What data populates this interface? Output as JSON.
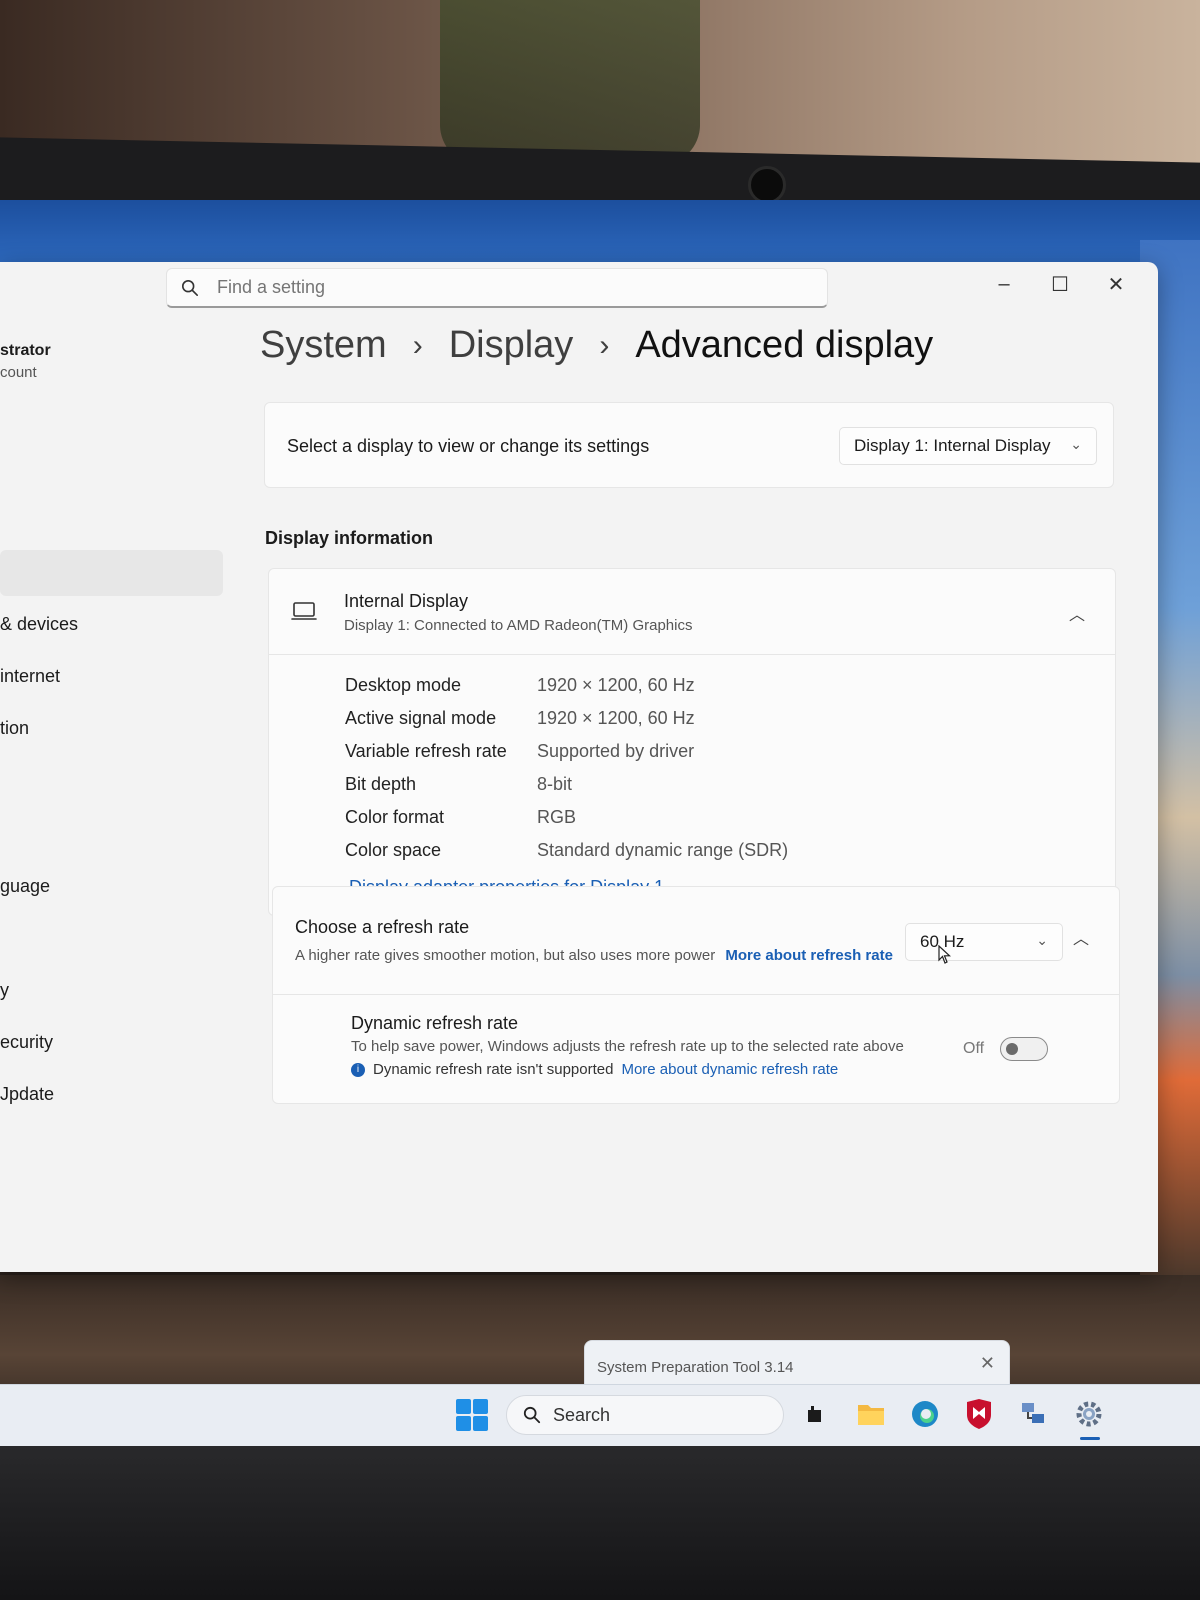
{
  "search": {
    "placeholder": "Find a setting"
  },
  "window_controls": {
    "minimize": "–",
    "maximize": "☐",
    "close": "✕"
  },
  "sidebar": {
    "user_name": "strator",
    "user_account": "count",
    "items": [
      {
        "label": "& devices"
      },
      {
        "label": "internet"
      },
      {
        "label": "tion"
      },
      {
        "label": "guage"
      },
      {
        "label": "y"
      },
      {
        "label": "ecurity"
      },
      {
        "label": "Jpdate"
      }
    ]
  },
  "breadcrumb": {
    "level1": "System",
    "level2": "Display",
    "current": "Advanced display",
    "separator": "›"
  },
  "select_display": {
    "label": "Select a display to view or change its settings",
    "value": "Display 1: Internal Display"
  },
  "display_info": {
    "section_title": "Display information",
    "name": "Internal Display",
    "subtitle": "Display 1: Connected to AMD Radeon(TM) Graphics",
    "properties": [
      {
        "key": "Desktop mode",
        "value": "1920 × 1200, 60 Hz"
      },
      {
        "key": "Active signal mode",
        "value": "1920 × 1200, 60 Hz"
      },
      {
        "key": "Variable refresh rate",
        "value": "Supported by driver"
      },
      {
        "key": "Bit depth",
        "value": "8-bit"
      },
      {
        "key": "Color format",
        "value": "RGB"
      },
      {
        "key": "Color space",
        "value": "Standard dynamic range (SDR)"
      }
    ],
    "adapter_link": "Display adapter properties for Display 1"
  },
  "refresh_rate": {
    "title": "Choose a refresh rate",
    "description": "A higher rate gives smoother motion, but also uses more power",
    "link": "More about refresh rate",
    "value": "60 Hz"
  },
  "dynamic_refresh": {
    "title": "Dynamic refresh rate",
    "description": "To help save power, Windows adjusts the refresh rate up to the selected rate above",
    "note": "Dynamic refresh rate isn't supported",
    "link": "More about dynamic refresh rate",
    "toggle_state": "Off"
  },
  "toast": {
    "text": "System Preparation Tool 3.14"
  },
  "taskbar": {
    "search_label": "Search"
  },
  "colors": {
    "accent": "#1a5fb4",
    "window_bg": "#f3f3f3",
    "card_bg": "#fbfbfb"
  }
}
